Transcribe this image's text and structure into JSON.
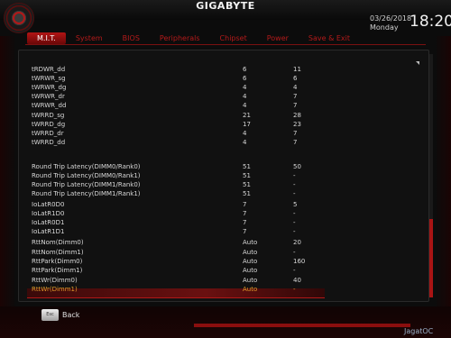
{
  "header": {
    "brand": "GIGABYTE",
    "date": "03/26/2018",
    "day": "Monday",
    "time": "18:20"
  },
  "tabs": [
    "M.I.T.",
    "System",
    "BIOS",
    "Peripherals",
    "Chipset",
    "Power",
    "Save & Exit"
  ],
  "active_tab": "M.I.T.",
  "rows": [
    {
      "name": "tRDWR_dd",
      "v1": "6",
      "v2": "11"
    },
    {
      "name": "tWRWR_sg",
      "v1": "6",
      "v2": "6"
    },
    {
      "name": "tWRWR_dg",
      "v1": "4",
      "v2": "4"
    },
    {
      "name": "tWRWR_dr",
      "v1": "4",
      "v2": "7"
    },
    {
      "name": "tWRWR_dd",
      "v1": "4",
      "v2": "7"
    },
    {
      "name": "tWRRD_sg",
      "v1": "21",
      "v2": "28"
    },
    {
      "name": "tWRRD_dg",
      "v1": "17",
      "v2": "23"
    },
    {
      "name": "tWRRD_dr",
      "v1": "4",
      "v2": "7"
    },
    {
      "name": "tWRRD_dd",
      "v1": "4",
      "v2": "7"
    },
    {
      "name": "Round Trip Latency(DIMM0/Rank0)",
      "v1": "51",
      "v2": "50"
    },
    {
      "name": "Round Trip Latency(DIMM0/Rank1)",
      "v1": "51",
      "v2": "-"
    },
    {
      "name": "Round Trip Latency(DIMM1/Rank0)",
      "v1": "51",
      "v2": "-"
    },
    {
      "name": "Round Trip Latency(DIMM1/Rank1)",
      "v1": "51",
      "v2": "-"
    },
    {
      "name": "IoLatR0D0",
      "v1": "7",
      "v2": "5"
    },
    {
      "name": "IoLatR1D0",
      "v1": "7",
      "v2": "-"
    },
    {
      "name": "IoLatR0D1",
      "v1": "7",
      "v2": "-"
    },
    {
      "name": "IoLatR1D1",
      "v1": "7",
      "v2": "-"
    },
    {
      "name": "RttNom(Dimm0)",
      "v1": "Auto",
      "v2": "20"
    },
    {
      "name": "RttNom(Dimm1)",
      "v1": "Auto",
      "v2": "-"
    },
    {
      "name": "RttPark(Dimm0)",
      "v1": "Auto",
      "v2": "160"
    },
    {
      "name": "RttPark(Dimm1)",
      "v1": "Auto",
      "v2": "-"
    },
    {
      "name": "RttWr(Dimm0)",
      "v1": "Auto",
      "v2": "40"
    },
    {
      "name": "RttWr(Dimm1)",
      "v1": "Auto",
      "v2": "-"
    }
  ],
  "selected_row": "RttWr(Dimm1)",
  "footer": {
    "back_key": "Esc",
    "back_label": "Back",
    "watermark": "JagatOC"
  }
}
